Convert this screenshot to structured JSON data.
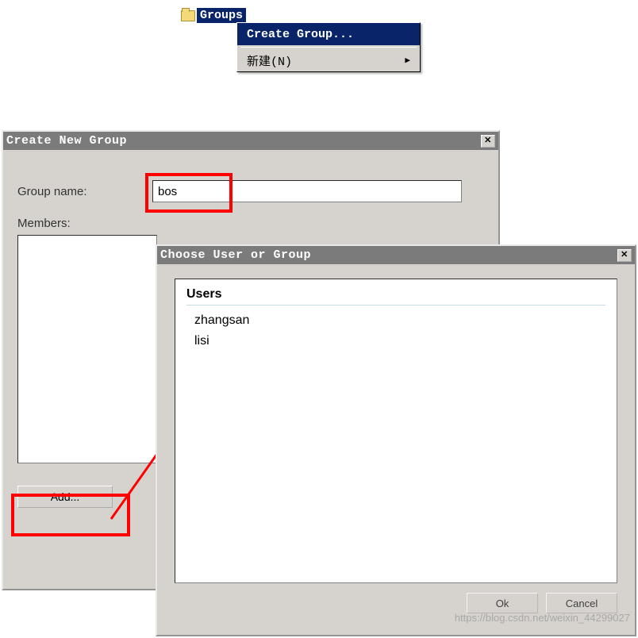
{
  "tree": {
    "node_label": "Groups"
  },
  "context_menu": {
    "items": [
      {
        "label": "Create Group...",
        "highlighted": true
      },
      {
        "label": "新建(N)",
        "submenu": true
      }
    ]
  },
  "create_group_dialog": {
    "title": "Create New Group",
    "group_name_label": "Group name:",
    "group_name_value": "bos",
    "members_label": "Members:",
    "add_button_label": "Add..."
  },
  "choose_dialog": {
    "title": "Choose User or Group",
    "list_header": "Users",
    "items": [
      "zhangsan",
      "lisi"
    ],
    "ok_label": "Ok",
    "cancel_label": "Cancel"
  },
  "watermark": "https://blog.csdn.net/weixin_44299027"
}
